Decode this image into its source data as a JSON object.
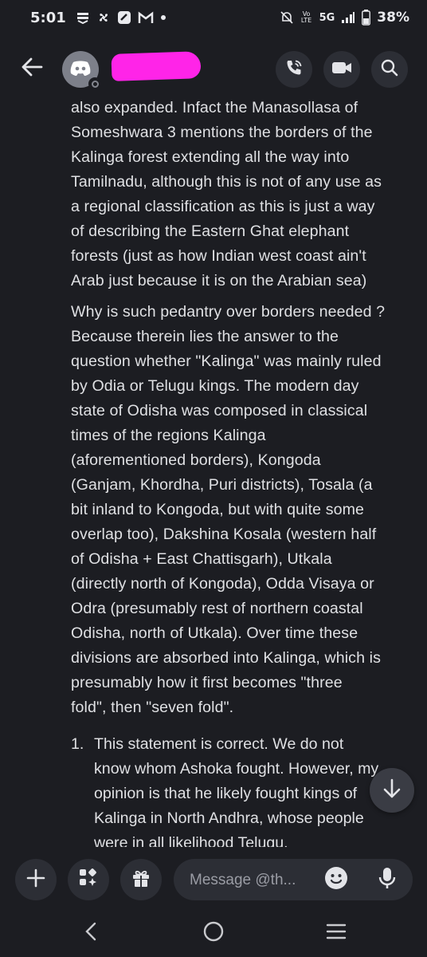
{
  "status_bar": {
    "time": "5:01",
    "network": "5G",
    "volte": "Vo LTE",
    "battery": "38%"
  },
  "header": {
    "icons": [
      "back-arrow-icon",
      "discord-logo-icon",
      "phone-call-icon",
      "video-camera-icon",
      "search-icon"
    ]
  },
  "messages": {
    "paragraph_1": "also expanded. Infact the Manasollasa of\nSomeshwara 3 mentions the borders of the\nKalinga forest extending all the way into\nTamilnadu, although this is not of any use as\na regional classification as this is just a way\nof describing the Eastern Ghat elephant\nforests (just as how Indian west coast ain't\nArab just because it is on the Arabian sea)",
    "paragraph_2": "Why is such pedantry over borders needed ?\nBecause therein lies the answer to the\nquestion whether \"Kalinga\" was mainly ruled\nby Odia or Telugu kings. The modern day\nstate of Odisha was composed in classical\ntimes of the regions Kalinga\n(aforementioned borders), Kongoda\n(Ganjam, Khordha, Puri districts), Tosala (a\nbit inland to Kongoda, but with quite some\noverlap too), Dakshina Kosala (western half\nof Odisha + East Chattisgarh), Utkala\n(directly north of Kongoda), Odda Visaya or\nOdra (presumably rest of northern coastal\nOdisha, north of Utkala). Over time these\ndivisions are absorbed into Kalinga, which is\npresumably how it first becomes \"three\nfold\", then \"seven fold\".",
    "list_item_1": {
      "number": "1.",
      "text": "This statement is correct. We do not\nknow whom Ashoka fought. However, my\nopinion is that he likely fought kings of\nKalinga in North Andhra, whose people\nwere in all likelihood Telugu."
    }
  },
  "composer": {
    "placeholder": "Message @th..."
  },
  "colors": {
    "background": "#1c1d22",
    "button_bg": "#2c2e35",
    "text": "#dfe0e3",
    "redaction": "#ff24e8"
  }
}
